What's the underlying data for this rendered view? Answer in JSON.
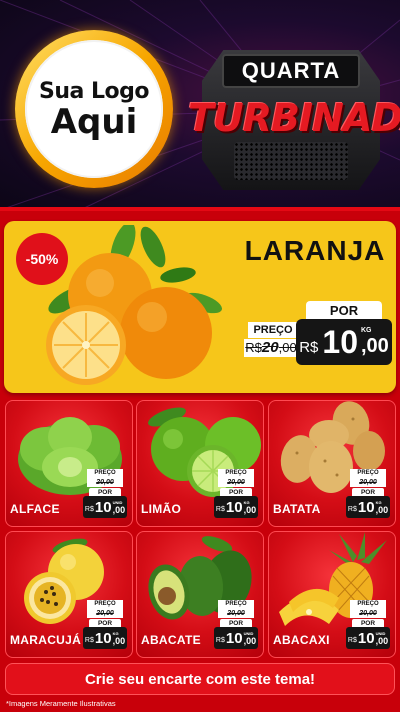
{
  "header": {
    "logo_line1": "Sua Logo",
    "logo_line2": "Aqui",
    "badge_top": "QUARTA",
    "badge_main": "TURBINADA"
  },
  "feature": {
    "discount": "-50%",
    "name": "LARANJA",
    "por_label": "POR",
    "preco_label": "PREÇO",
    "old_price_int": "20",
    "old_price_cents": ",00",
    "currency": "R$",
    "price_int": "10",
    "price_cents": ",00",
    "unit": "KG"
  },
  "products": [
    {
      "name": "ALFACE",
      "preco_label": "PREÇO",
      "old_price": "20,00",
      "por_label": "POR",
      "currency": "R$",
      "price_int": "10",
      "price_cents": ",00",
      "unit": "UNID"
    },
    {
      "name": "LIMÃO",
      "preco_label": "PREÇO",
      "old_price": "20,00",
      "por_label": "POR",
      "currency": "R$",
      "price_int": "10",
      "price_cents": ",00",
      "unit": "KG"
    },
    {
      "name": "BATATA",
      "preco_label": "PREÇO",
      "old_price": "20,00",
      "por_label": "POR",
      "currency": "R$",
      "price_int": "10",
      "price_cents": ",00",
      "unit": "KG"
    },
    {
      "name": "MARACUJÁ",
      "preco_label": "PREÇO",
      "old_price": "20,00",
      "por_label": "POR",
      "currency": "R$",
      "price_int": "10",
      "price_cents": ",00",
      "unit": "KG"
    },
    {
      "name": "ABACATE",
      "preco_label": "PREÇO",
      "old_price": "20,00",
      "por_label": "POR",
      "currency": "R$",
      "price_int": "10",
      "price_cents": ",00",
      "unit": "UNID"
    },
    {
      "name": "ABACAXI",
      "preco_label": "PREÇO",
      "old_price": "20,00",
      "por_label": "POR",
      "currency": "R$",
      "price_int": "10",
      "price_cents": ",00",
      "unit": "UNID"
    }
  ],
  "footer": {
    "cta": "Crie seu encarte com este tema!",
    "disclaimer": "*Imagens Meramente Ilustrativas"
  },
  "colors": {
    "background_red": "#c8000a",
    "feature_yellow": "#f6c61a",
    "price_black": "#151515",
    "header_dark": "#1c0a2e",
    "logo_gold": "#f7a600"
  }
}
